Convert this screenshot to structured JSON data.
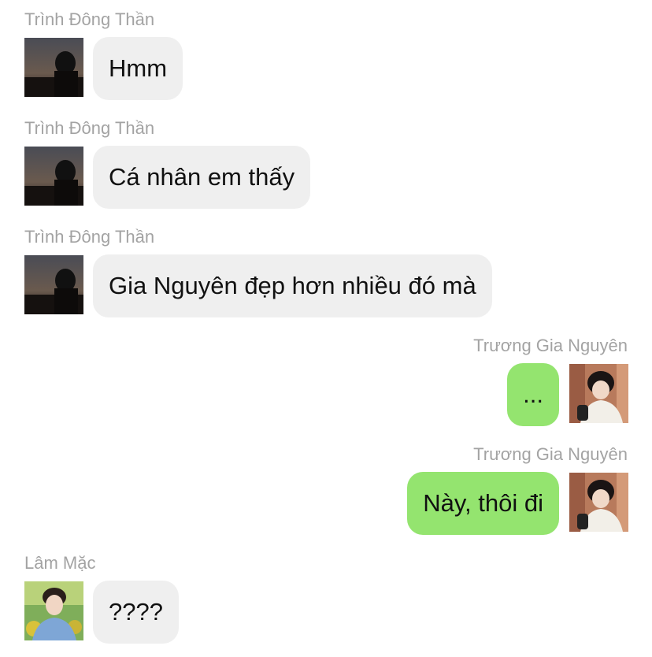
{
  "messages": [
    {
      "sender": "Trình Đông Thần",
      "text": "Hmm",
      "side": "left",
      "avatar": "dark-sunset-avatar"
    },
    {
      "sender": "Trình Đông Thần",
      "text": "Cá nhân em thấy",
      "side": "left",
      "avatar": "dark-sunset-avatar"
    },
    {
      "sender": "Trình Đông Thần",
      "text": "Gia Nguyên đẹp hơn nhiều đó mà",
      "side": "left",
      "avatar": "dark-sunset-avatar"
    },
    {
      "sender": "Trương Gia Nguyên",
      "text": "...",
      "side": "right",
      "avatar": "boy-white-shirt-avatar"
    },
    {
      "sender": "Trương Gia Nguyên",
      "text": "Này, thôi đi",
      "side": "right",
      "avatar": "boy-white-shirt-avatar"
    },
    {
      "sender": "Lâm Mặc",
      "text": "????",
      "side": "left",
      "avatar": "boy-blue-shirt-avatar"
    }
  ],
  "colors": {
    "incoming_bubble": "#efefef",
    "outgoing_bubble": "#94e46f",
    "sender_name": "#a3a3a3"
  }
}
